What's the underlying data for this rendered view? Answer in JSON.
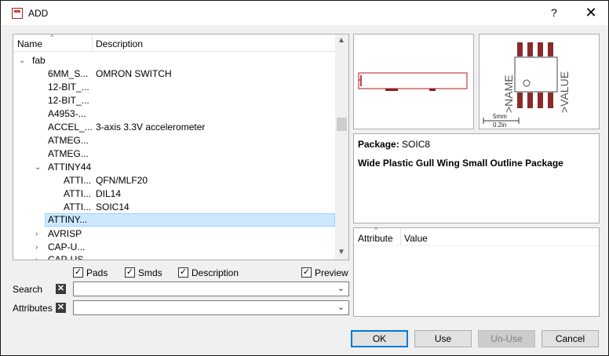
{
  "window": {
    "title": "ADD",
    "icon_text": "SCH",
    "help": "?",
    "close": "✕"
  },
  "tree": {
    "headers": {
      "name": "Name",
      "description": "Description"
    },
    "rows": [
      {
        "arrow": "⌄",
        "name": "fab",
        "desc": ""
      },
      {
        "arrow": "",
        "name": "6MM_S...",
        "desc": "OMRON SWITCH"
      },
      {
        "arrow": "",
        "name": "12-BIT_...",
        "desc": ""
      },
      {
        "arrow": "",
        "name": "12-BIT_...",
        "desc": ""
      },
      {
        "arrow": "",
        "name": "A4953-...",
        "desc": ""
      },
      {
        "arrow": "",
        "name": "ACCEL_...",
        "desc": "3-axis 3.3V accelerometer"
      },
      {
        "arrow": "",
        "name": "ATMEG...",
        "desc": ""
      },
      {
        "arrow": "",
        "name": "ATMEG...",
        "desc": ""
      },
      {
        "arrow": "⌄",
        "name": "ATTINY44",
        "desc": ""
      },
      {
        "arrow": "",
        "name": "ATTI...",
        "desc": "QFN/MLF20"
      },
      {
        "arrow": "",
        "name": "ATTI...",
        "desc": "DIL14"
      },
      {
        "arrow": "",
        "name": "ATTI...",
        "desc": "SOIC14"
      },
      {
        "arrow": "",
        "name": "ATTINY...",
        "desc": ""
      },
      {
        "arrow": "›",
        "name": "AVRISP",
        "desc": ""
      },
      {
        "arrow": "›",
        "name": "CAP-U...",
        "desc": ""
      },
      {
        "arrow": "›",
        "name": "CAP-US...",
        "desc": ""
      }
    ],
    "selected_index": 12
  },
  "options": {
    "pads": {
      "label": "Pads",
      "checked": true
    },
    "smds": {
      "label": "Smds",
      "checked": true
    },
    "description": {
      "label": "Description",
      "checked": true
    },
    "preview": {
      "label": "Preview",
      "checked": true
    }
  },
  "search": {
    "label": "Search",
    "value": ""
  },
  "attributes": {
    "label": "Attributes",
    "value": ""
  },
  "symbol_preview": {
    "name": ">NAME",
    "value": ">VALUE",
    "scale_mm": "5mm",
    "scale_in": "0.2in"
  },
  "info": {
    "package_label": "Package:",
    "package_value": "SOIC8",
    "description": "Wide Plastic Gull Wing Small Outline Package"
  },
  "attribute_table": {
    "col1": "Attribute",
    "col2": "Value"
  },
  "buttons": {
    "ok": "OK",
    "use": "Use",
    "unuse": "Un-Use",
    "cancel": "Cancel"
  },
  "colors": {
    "selection": "#cce8ff",
    "pad": "#8b2222",
    "outline": "#c04040"
  }
}
